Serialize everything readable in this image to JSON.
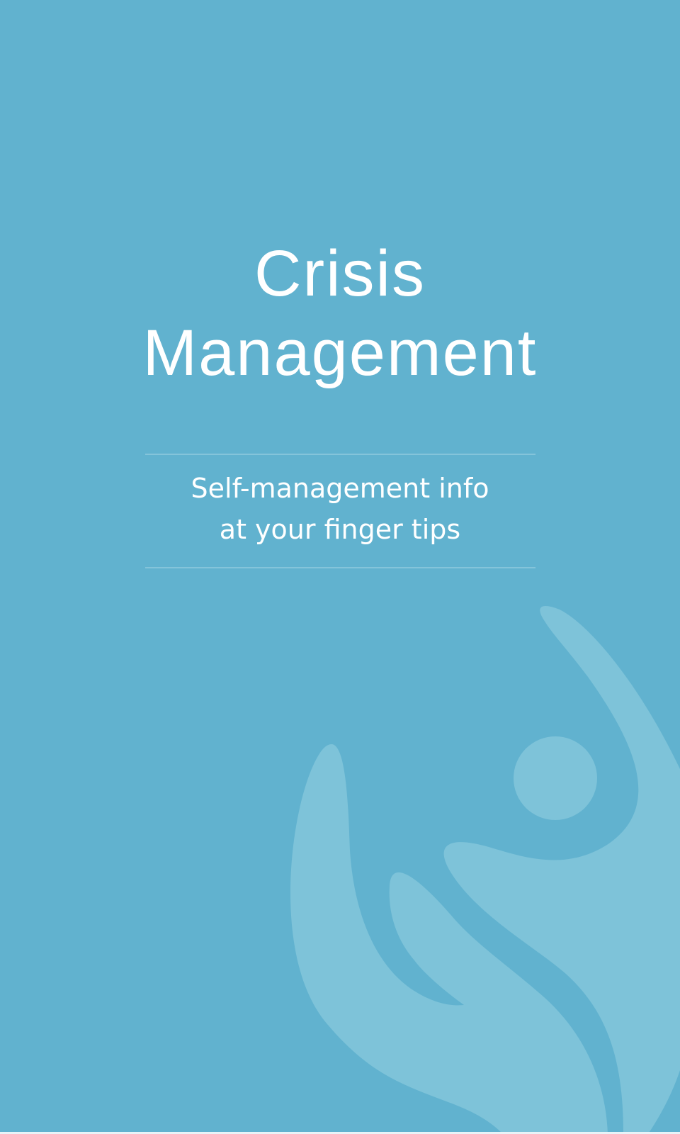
{
  "title": {
    "line1": "Crisis",
    "line2": "Management"
  },
  "subtitle": {
    "line1": "Self-management info",
    "line2": "at your finger tips"
  },
  "logo_icon": "hand-holding-person-icon",
  "colors": {
    "background": "#61b2cf",
    "logo_fill": "#7ec3d9",
    "text": "#ffffff",
    "divider": "#84c4da"
  }
}
